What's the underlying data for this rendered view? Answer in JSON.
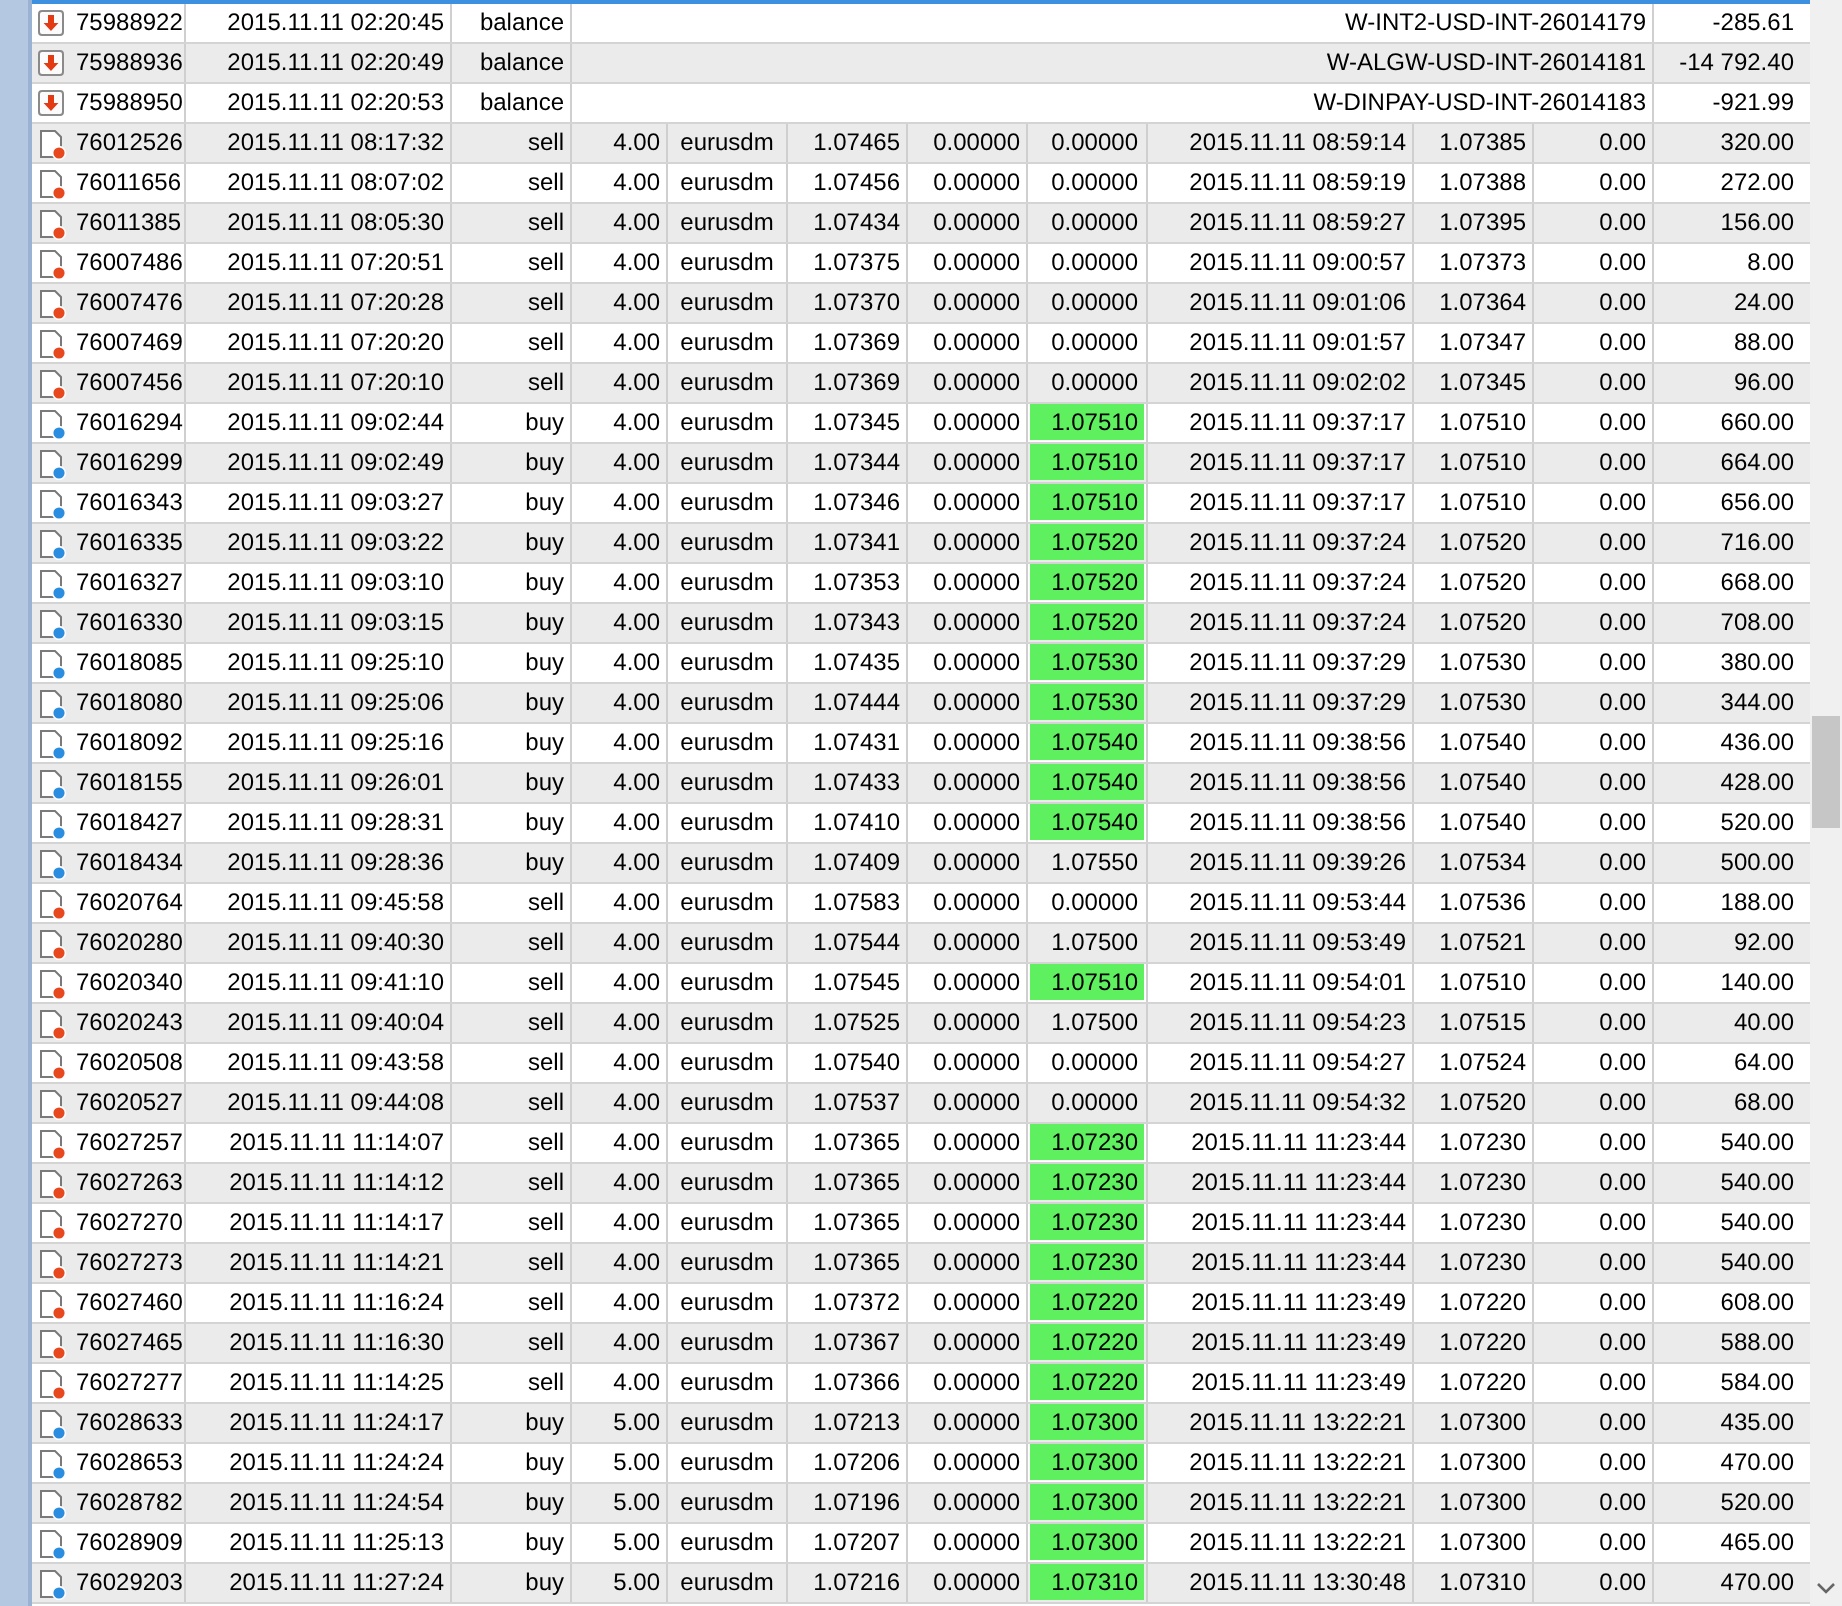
{
  "table": {
    "rows": [
      {
        "kind": "balance",
        "ticket": "75988922",
        "time": "2015.11.11 02:20:45",
        "type": "balance",
        "comment": "W-INT2-USD-INT-26014179",
        "profit": "-285.61"
      },
      {
        "kind": "balance",
        "ticket": "75988936",
        "time": "2015.11.11 02:20:49",
        "type": "balance",
        "comment": "W-ALGW-USD-INT-26014181",
        "profit": "-14 792.40"
      },
      {
        "kind": "balance",
        "ticket": "75988950",
        "time": "2015.11.11 02:20:53",
        "type": "balance",
        "comment": "W-DINPAY-USD-INT-26014183",
        "profit": "-921.99"
      },
      {
        "kind": "sell",
        "ticket": "76012526",
        "time": "2015.11.11 08:17:32",
        "type": "sell",
        "size": "4.00",
        "symbol": "eurusdm",
        "price": "1.07465",
        "sl": "0.00000",
        "tp": "0.00000",
        "tp_hit": false,
        "close_time": "2015.11.11 08:59:14",
        "close_price": "1.07385",
        "commission": "0.00",
        "profit": "320.00"
      },
      {
        "kind": "sell",
        "ticket": "76011656",
        "time": "2015.11.11 08:07:02",
        "type": "sell",
        "size": "4.00",
        "symbol": "eurusdm",
        "price": "1.07456",
        "sl": "0.00000",
        "tp": "0.00000",
        "tp_hit": false,
        "close_time": "2015.11.11 08:59:19",
        "close_price": "1.07388",
        "commission": "0.00",
        "profit": "272.00"
      },
      {
        "kind": "sell",
        "ticket": "76011385",
        "time": "2015.11.11 08:05:30",
        "type": "sell",
        "size": "4.00",
        "symbol": "eurusdm",
        "price": "1.07434",
        "sl": "0.00000",
        "tp": "0.00000",
        "tp_hit": false,
        "close_time": "2015.11.11 08:59:27",
        "close_price": "1.07395",
        "commission": "0.00",
        "profit": "156.00"
      },
      {
        "kind": "sell",
        "ticket": "76007486",
        "time": "2015.11.11 07:20:51",
        "type": "sell",
        "size": "4.00",
        "symbol": "eurusdm",
        "price": "1.07375",
        "sl": "0.00000",
        "tp": "0.00000",
        "tp_hit": false,
        "close_time": "2015.11.11 09:00:57",
        "close_price": "1.07373",
        "commission": "0.00",
        "profit": "8.00"
      },
      {
        "kind": "sell",
        "ticket": "76007476",
        "time": "2015.11.11 07:20:28",
        "type": "sell",
        "size": "4.00",
        "symbol": "eurusdm",
        "price": "1.07370",
        "sl": "0.00000",
        "tp": "0.00000",
        "tp_hit": false,
        "close_time": "2015.11.11 09:01:06",
        "close_price": "1.07364",
        "commission": "0.00",
        "profit": "24.00"
      },
      {
        "kind": "sell",
        "ticket": "76007469",
        "time": "2015.11.11 07:20:20",
        "type": "sell",
        "size": "4.00",
        "symbol": "eurusdm",
        "price": "1.07369",
        "sl": "0.00000",
        "tp": "0.00000",
        "tp_hit": false,
        "close_time": "2015.11.11 09:01:57",
        "close_price": "1.07347",
        "commission": "0.00",
        "profit": "88.00"
      },
      {
        "kind": "sell",
        "ticket": "76007456",
        "time": "2015.11.11 07:20:10",
        "type": "sell",
        "size": "4.00",
        "symbol": "eurusdm",
        "price": "1.07369",
        "sl": "0.00000",
        "tp": "0.00000",
        "tp_hit": false,
        "close_time": "2015.11.11 09:02:02",
        "close_price": "1.07345",
        "commission": "0.00",
        "profit": "96.00"
      },
      {
        "kind": "buy",
        "ticket": "76016294",
        "time": "2015.11.11 09:02:44",
        "type": "buy",
        "size": "4.00",
        "symbol": "eurusdm",
        "price": "1.07345",
        "sl": "0.00000",
        "tp": "1.07510",
        "tp_hit": true,
        "close_time": "2015.11.11 09:37:17",
        "close_price": "1.07510",
        "commission": "0.00",
        "profit": "660.00"
      },
      {
        "kind": "buy",
        "ticket": "76016299",
        "time": "2015.11.11 09:02:49",
        "type": "buy",
        "size": "4.00",
        "symbol": "eurusdm",
        "price": "1.07344",
        "sl": "0.00000",
        "tp": "1.07510",
        "tp_hit": true,
        "close_time": "2015.11.11 09:37:17",
        "close_price": "1.07510",
        "commission": "0.00",
        "profit": "664.00"
      },
      {
        "kind": "buy",
        "ticket": "76016343",
        "time": "2015.11.11 09:03:27",
        "type": "buy",
        "size": "4.00",
        "symbol": "eurusdm",
        "price": "1.07346",
        "sl": "0.00000",
        "tp": "1.07510",
        "tp_hit": true,
        "close_time": "2015.11.11 09:37:17",
        "close_price": "1.07510",
        "commission": "0.00",
        "profit": "656.00"
      },
      {
        "kind": "buy",
        "ticket": "76016335",
        "time": "2015.11.11 09:03:22",
        "type": "buy",
        "size": "4.00",
        "symbol": "eurusdm",
        "price": "1.07341",
        "sl": "0.00000",
        "tp": "1.07520",
        "tp_hit": true,
        "close_time": "2015.11.11 09:37:24",
        "close_price": "1.07520",
        "commission": "0.00",
        "profit": "716.00"
      },
      {
        "kind": "buy",
        "ticket": "76016327",
        "time": "2015.11.11 09:03:10",
        "type": "buy",
        "size": "4.00",
        "symbol": "eurusdm",
        "price": "1.07353",
        "sl": "0.00000",
        "tp": "1.07520",
        "tp_hit": true,
        "close_time": "2015.11.11 09:37:24",
        "close_price": "1.07520",
        "commission": "0.00",
        "profit": "668.00"
      },
      {
        "kind": "buy",
        "ticket": "76016330",
        "time": "2015.11.11 09:03:15",
        "type": "buy",
        "size": "4.00",
        "symbol": "eurusdm",
        "price": "1.07343",
        "sl": "0.00000",
        "tp": "1.07520",
        "tp_hit": true,
        "close_time": "2015.11.11 09:37:24",
        "close_price": "1.07520",
        "commission": "0.00",
        "profit": "708.00"
      },
      {
        "kind": "buy",
        "ticket": "76018085",
        "time": "2015.11.11 09:25:10",
        "type": "buy",
        "size": "4.00",
        "symbol": "eurusdm",
        "price": "1.07435",
        "sl": "0.00000",
        "tp": "1.07530",
        "tp_hit": true,
        "close_time": "2015.11.11 09:37:29",
        "close_price": "1.07530",
        "commission": "0.00",
        "profit": "380.00"
      },
      {
        "kind": "buy",
        "ticket": "76018080",
        "time": "2015.11.11 09:25:06",
        "type": "buy",
        "size": "4.00",
        "symbol": "eurusdm",
        "price": "1.07444",
        "sl": "0.00000",
        "tp": "1.07530",
        "tp_hit": true,
        "close_time": "2015.11.11 09:37:29",
        "close_price": "1.07530",
        "commission": "0.00",
        "profit": "344.00"
      },
      {
        "kind": "buy",
        "ticket": "76018092",
        "time": "2015.11.11 09:25:16",
        "type": "buy",
        "size": "4.00",
        "symbol": "eurusdm",
        "price": "1.07431",
        "sl": "0.00000",
        "tp": "1.07540",
        "tp_hit": true,
        "close_time": "2015.11.11 09:38:56",
        "close_price": "1.07540",
        "commission": "0.00",
        "profit": "436.00"
      },
      {
        "kind": "buy",
        "ticket": "76018155",
        "time": "2015.11.11 09:26:01",
        "type": "buy",
        "size": "4.00",
        "symbol": "eurusdm",
        "price": "1.07433",
        "sl": "0.00000",
        "tp": "1.07540",
        "tp_hit": true,
        "close_time": "2015.11.11 09:38:56",
        "close_price": "1.07540",
        "commission": "0.00",
        "profit": "428.00"
      },
      {
        "kind": "buy",
        "ticket": "76018427",
        "time": "2015.11.11 09:28:31",
        "type": "buy",
        "size": "4.00",
        "symbol": "eurusdm",
        "price": "1.07410",
        "sl": "0.00000",
        "tp": "1.07540",
        "tp_hit": true,
        "close_time": "2015.11.11 09:38:56",
        "close_price": "1.07540",
        "commission": "0.00",
        "profit": "520.00"
      },
      {
        "kind": "buy",
        "ticket": "76018434",
        "time": "2015.11.11 09:28:36",
        "type": "buy",
        "size": "4.00",
        "symbol": "eurusdm",
        "price": "1.07409",
        "sl": "0.00000",
        "tp": "1.07550",
        "tp_hit": false,
        "close_time": "2015.11.11 09:39:26",
        "close_price": "1.07534",
        "commission": "0.00",
        "profit": "500.00"
      },
      {
        "kind": "sell",
        "ticket": "76020764",
        "time": "2015.11.11 09:45:58",
        "type": "sell",
        "size": "4.00",
        "symbol": "eurusdm",
        "price": "1.07583",
        "sl": "0.00000",
        "tp": "0.00000",
        "tp_hit": false,
        "close_time": "2015.11.11 09:53:44",
        "close_price": "1.07536",
        "commission": "0.00",
        "profit": "188.00"
      },
      {
        "kind": "sell",
        "ticket": "76020280",
        "time": "2015.11.11 09:40:30",
        "type": "sell",
        "size": "4.00",
        "symbol": "eurusdm",
        "price": "1.07544",
        "sl": "0.00000",
        "tp": "1.07500",
        "tp_hit": false,
        "close_time": "2015.11.11 09:53:49",
        "close_price": "1.07521",
        "commission": "0.00",
        "profit": "92.00"
      },
      {
        "kind": "sell",
        "ticket": "76020340",
        "time": "2015.11.11 09:41:10",
        "type": "sell",
        "size": "4.00",
        "symbol": "eurusdm",
        "price": "1.07545",
        "sl": "0.00000",
        "tp": "1.07510",
        "tp_hit": true,
        "close_time": "2015.11.11 09:54:01",
        "close_price": "1.07510",
        "commission": "0.00",
        "profit": "140.00"
      },
      {
        "kind": "sell",
        "ticket": "76020243",
        "time": "2015.11.11 09:40:04",
        "type": "sell",
        "size": "4.00",
        "symbol": "eurusdm",
        "price": "1.07525",
        "sl": "0.00000",
        "tp": "1.07500",
        "tp_hit": false,
        "close_time": "2015.11.11 09:54:23",
        "close_price": "1.07515",
        "commission": "0.00",
        "profit": "40.00"
      },
      {
        "kind": "sell",
        "ticket": "76020508",
        "time": "2015.11.11 09:43:58",
        "type": "sell",
        "size": "4.00",
        "symbol": "eurusdm",
        "price": "1.07540",
        "sl": "0.00000",
        "tp": "0.00000",
        "tp_hit": false,
        "close_time": "2015.11.11 09:54:27",
        "close_price": "1.07524",
        "commission": "0.00",
        "profit": "64.00"
      },
      {
        "kind": "sell",
        "ticket": "76020527",
        "time": "2015.11.11 09:44:08",
        "type": "sell",
        "size": "4.00",
        "symbol": "eurusdm",
        "price": "1.07537",
        "sl": "0.00000",
        "tp": "0.00000",
        "tp_hit": false,
        "close_time": "2015.11.11 09:54:32",
        "close_price": "1.07520",
        "commission": "0.00",
        "profit": "68.00"
      },
      {
        "kind": "sell",
        "ticket": "76027257",
        "time": "2015.11.11 11:14:07",
        "type": "sell",
        "size": "4.00",
        "symbol": "eurusdm",
        "price": "1.07365",
        "sl": "0.00000",
        "tp": "1.07230",
        "tp_hit": true,
        "close_time": "2015.11.11 11:23:44",
        "close_price": "1.07230",
        "commission": "0.00",
        "profit": "540.00"
      },
      {
        "kind": "sell",
        "ticket": "76027263",
        "time": "2015.11.11 11:14:12",
        "type": "sell",
        "size": "4.00",
        "symbol": "eurusdm",
        "price": "1.07365",
        "sl": "0.00000",
        "tp": "1.07230",
        "tp_hit": true,
        "close_time": "2015.11.11 11:23:44",
        "close_price": "1.07230",
        "commission": "0.00",
        "profit": "540.00"
      },
      {
        "kind": "sell",
        "ticket": "76027270",
        "time": "2015.11.11 11:14:17",
        "type": "sell",
        "size": "4.00",
        "symbol": "eurusdm",
        "price": "1.07365",
        "sl": "0.00000",
        "tp": "1.07230",
        "tp_hit": true,
        "close_time": "2015.11.11 11:23:44",
        "close_price": "1.07230",
        "commission": "0.00",
        "profit": "540.00"
      },
      {
        "kind": "sell",
        "ticket": "76027273",
        "time": "2015.11.11 11:14:21",
        "type": "sell",
        "size": "4.00",
        "symbol": "eurusdm",
        "price": "1.07365",
        "sl": "0.00000",
        "tp": "1.07230",
        "tp_hit": true,
        "close_time": "2015.11.11 11:23:44",
        "close_price": "1.07230",
        "commission": "0.00",
        "profit": "540.00"
      },
      {
        "kind": "sell",
        "ticket": "76027460",
        "time": "2015.11.11 11:16:24",
        "type": "sell",
        "size": "4.00",
        "symbol": "eurusdm",
        "price": "1.07372",
        "sl": "0.00000",
        "tp": "1.07220",
        "tp_hit": true,
        "close_time": "2015.11.11 11:23:49",
        "close_price": "1.07220",
        "commission": "0.00",
        "profit": "608.00"
      },
      {
        "kind": "sell",
        "ticket": "76027465",
        "time": "2015.11.11 11:16:30",
        "type": "sell",
        "size": "4.00",
        "symbol": "eurusdm",
        "price": "1.07367",
        "sl": "0.00000",
        "tp": "1.07220",
        "tp_hit": true,
        "close_time": "2015.11.11 11:23:49",
        "close_price": "1.07220",
        "commission": "0.00",
        "profit": "588.00"
      },
      {
        "kind": "sell",
        "ticket": "76027277",
        "time": "2015.11.11 11:14:25",
        "type": "sell",
        "size": "4.00",
        "symbol": "eurusdm",
        "price": "1.07366",
        "sl": "0.00000",
        "tp": "1.07220",
        "tp_hit": true,
        "close_time": "2015.11.11 11:23:49",
        "close_price": "1.07220",
        "commission": "0.00",
        "profit": "584.00"
      },
      {
        "kind": "buy",
        "ticket": "76028633",
        "time": "2015.11.11 11:24:17",
        "type": "buy",
        "size": "5.00",
        "symbol": "eurusdm",
        "price": "1.07213",
        "sl": "0.00000",
        "tp": "1.07300",
        "tp_hit": true,
        "close_time": "2015.11.11 13:22:21",
        "close_price": "1.07300",
        "commission": "0.00",
        "profit": "435.00"
      },
      {
        "kind": "buy",
        "ticket": "76028653",
        "time": "2015.11.11 11:24:24",
        "type": "buy",
        "size": "5.00",
        "symbol": "eurusdm",
        "price": "1.07206",
        "sl": "0.00000",
        "tp": "1.07300",
        "tp_hit": true,
        "close_time": "2015.11.11 13:22:21",
        "close_price": "1.07300",
        "commission": "0.00",
        "profit": "470.00"
      },
      {
        "kind": "buy",
        "ticket": "76028782",
        "time": "2015.11.11 11:24:54",
        "type": "buy",
        "size": "5.00",
        "symbol": "eurusdm",
        "price": "1.07196",
        "sl": "0.00000",
        "tp": "1.07300",
        "tp_hit": true,
        "close_time": "2015.11.11 13:22:21",
        "close_price": "1.07300",
        "commission": "0.00",
        "profit": "520.00"
      },
      {
        "kind": "buy",
        "ticket": "76028909",
        "time": "2015.11.11 11:25:13",
        "type": "buy",
        "size": "5.00",
        "symbol": "eurusdm",
        "price": "1.07207",
        "sl": "0.00000",
        "tp": "1.07300",
        "tp_hit": true,
        "close_time": "2015.11.11 13:22:21",
        "close_price": "1.07300",
        "commission": "0.00",
        "profit": "465.00"
      },
      {
        "kind": "buy",
        "ticket": "76029203",
        "time": "2015.11.11 11:27:24",
        "type": "buy",
        "size": "5.00",
        "symbol": "eurusdm",
        "price": "1.07216",
        "sl": "0.00000",
        "tp": "1.07310",
        "tp_hit": true,
        "close_time": "2015.11.11 13:30:48",
        "close_price": "1.07310",
        "commission": "0.00",
        "profit": "470.00"
      }
    ]
  }
}
